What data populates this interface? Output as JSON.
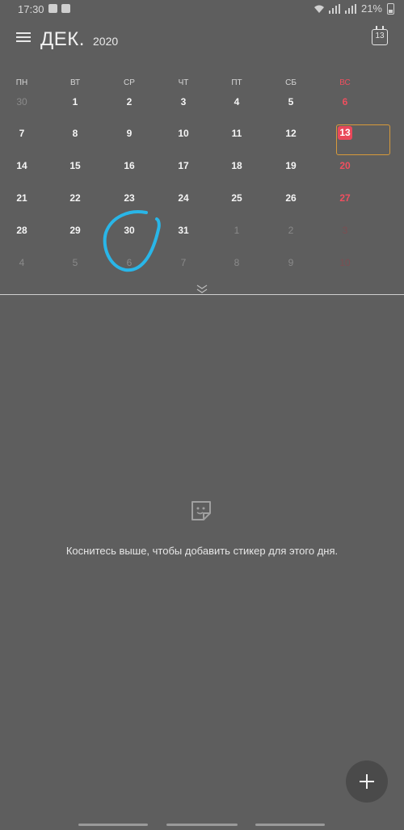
{
  "status_bar": {
    "time": "17:30",
    "battery": "21%"
  },
  "header": {
    "month": "ДЕК.",
    "year": "2020",
    "today_icon_day": "13",
    "menu_icon": "hamburger-menu-icon"
  },
  "calendar": {
    "weekdays": [
      "ПН",
      "ВТ",
      "СР",
      "ЧТ",
      "ПТ",
      "СБ",
      "ВС"
    ],
    "today": "13",
    "today_color": "#e9485a",
    "sunday_color": "#ef4f5f",
    "weeks": [
      [
        {
          "d": "30",
          "o": 1
        },
        {
          "d": "1"
        },
        {
          "d": "2"
        },
        {
          "d": "3"
        },
        {
          "d": "4"
        },
        {
          "d": "5"
        },
        {
          "d": "6"
        }
      ],
      [
        {
          "d": "7"
        },
        {
          "d": "8"
        },
        {
          "d": "9"
        },
        {
          "d": "10"
        },
        {
          "d": "11"
        },
        {
          "d": "12"
        },
        {
          "d": "13",
          "t": 1
        }
      ],
      [
        {
          "d": "14"
        },
        {
          "d": "15"
        },
        {
          "d": "16"
        },
        {
          "d": "17"
        },
        {
          "d": "18"
        },
        {
          "d": "19"
        },
        {
          "d": "20"
        }
      ],
      [
        {
          "d": "21"
        },
        {
          "d": "22"
        },
        {
          "d": "23"
        },
        {
          "d": "24"
        },
        {
          "d": "25"
        },
        {
          "d": "26"
        },
        {
          "d": "27"
        }
      ],
      [
        {
          "d": "28"
        },
        {
          "d": "29"
        },
        {
          "d": "30"
        },
        {
          "d": "31"
        },
        {
          "d": "1",
          "o": 1
        },
        {
          "d": "2",
          "o": 1
        },
        {
          "d": "3",
          "o": 1
        }
      ],
      [
        {
          "d": "4",
          "o": 1
        },
        {
          "d": "5",
          "o": 1
        },
        {
          "d": "6",
          "o": 1
        },
        {
          "d": "7",
          "o": 1
        },
        {
          "d": "8",
          "o": 1
        },
        {
          "d": "9",
          "o": 1
        },
        {
          "d": "10",
          "o": 1
        }
      ]
    ]
  },
  "empty_state": {
    "icon": "sticker-icon",
    "hint": "Коснитесь выше, чтобы добавить стикер для этого дня."
  },
  "fab": {
    "icon": "plus-icon"
  },
  "annotation_color": "#29b6e8"
}
